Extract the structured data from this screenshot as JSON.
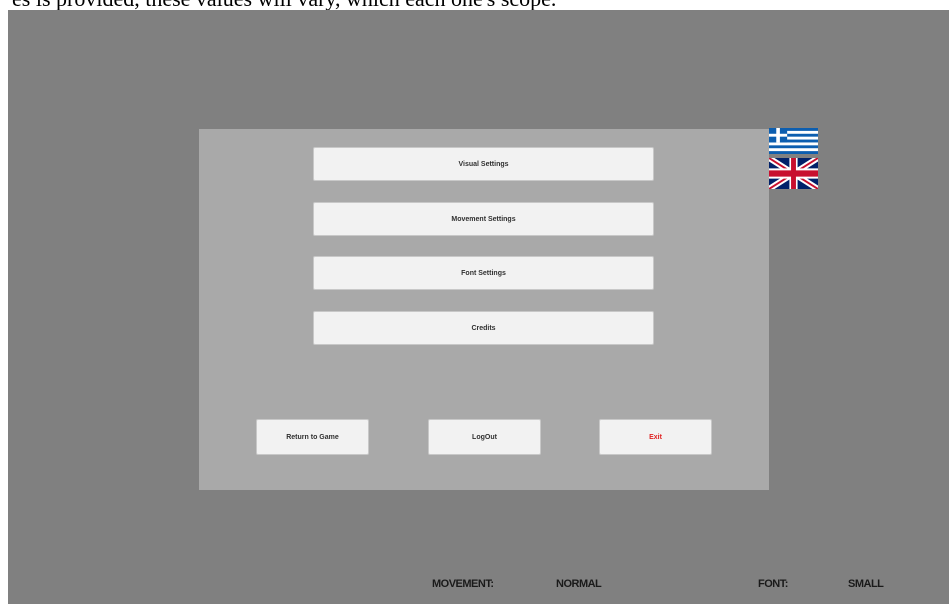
{
  "caption": "es is provided, these values will vary, which each one's scope.",
  "menu": {
    "visual_settings": "Visual Settings",
    "movement_settings": "Movement Settings",
    "font_settings": "Font Settings",
    "credits": "Credits"
  },
  "actions": {
    "return_to_game": "Return to Game",
    "logout": "LogOut",
    "exit": "Exit"
  },
  "languages": [
    "greek-flag-icon",
    "uk-flag-icon"
  ],
  "status": {
    "movement_label": "MOVEMENT:",
    "movement_value": "NORMAL",
    "font_label": "FONT:",
    "font_value": "SMALL"
  },
  "colors": {
    "background": "#808080",
    "panel": "#a9a9a9",
    "button": "#f2f2f2",
    "exit_text": "#e02020"
  }
}
